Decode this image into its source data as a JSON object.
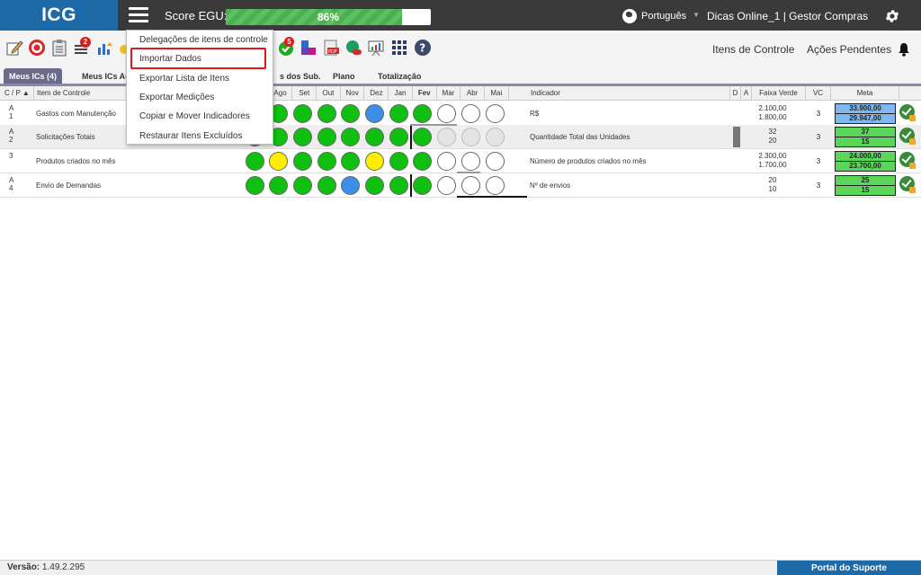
{
  "header": {
    "logo": "ICG",
    "score_label": "Score EGU:",
    "score_percent": 86,
    "score_text": "86%",
    "language": "Português",
    "user": "Dicas Online_1  |  Gestor Compras"
  },
  "toolbar": {
    "badge1": "2",
    "badge2": "5",
    "right_links": [
      "Itens de Controle",
      "Ações Pendentes"
    ]
  },
  "tabs": [
    {
      "label": "Meus ICs (4)",
      "active": true
    },
    {
      "label": "Meus ICs Au",
      "active": false
    },
    {
      "label": "s dos Sub.",
      "active": false
    },
    {
      "label": "Plano",
      "active": false
    },
    {
      "label": "Totalização",
      "active": false
    }
  ],
  "table": {
    "headers": {
      "cp": "C / P",
      "item": "Item de Controle",
      "months": [
        "ul",
        "Ago",
        "Set",
        "Out",
        "Nov",
        "Dez",
        "Jan",
        "Fev",
        "Mar",
        "Abr",
        "Mai"
      ],
      "indicator": "Indicador",
      "d": "D",
      "a": "A",
      "fv": "Faixa Verde",
      "vc": "VC",
      "meta": "Meta"
    },
    "rows": [
      {
        "cp": [
          "A",
          "1"
        ],
        "item": "Gastos com Manutenção",
        "status": [
          "green",
          "green",
          "green",
          "green",
          "green",
          "blue",
          "green",
          "green",
          "empty",
          "empty",
          "empty"
        ],
        "indicator": "R$",
        "fv": [
          "2.100,00",
          "1.800,00"
        ],
        "vc": "3",
        "meta": [
          "33.900,00",
          "29.947,00"
        ],
        "meta_color": "#7fb8ef"
      },
      {
        "cp": [
          "A",
          "2"
        ],
        "item": "Solicitações Totais",
        "status": [
          "green",
          "green",
          "green",
          "green",
          "green",
          "green",
          "green",
          "green",
          "gray",
          "gray",
          "gray"
        ],
        "indicator": "Quantidade Total das Unidades",
        "fv": [
          "32",
          "20"
        ],
        "vc": "3",
        "meta": [
          "37",
          "15"
        ],
        "meta_color": "#5bd65b"
      },
      {
        "cp": [
          "",
          "3"
        ],
        "item": "Produtos criados no mês",
        "status": [
          "green",
          "yellow",
          "green",
          "green",
          "green",
          "yellow",
          "green",
          "green",
          "empty",
          "empty",
          "empty"
        ],
        "indicator": "Número de produtos criados no mês",
        "fv": [
          "2.300,00",
          "1.700,00"
        ],
        "vc": "3",
        "meta": [
          "24.000,00",
          "23.700,00"
        ],
        "meta_color": "#5bd65b"
      },
      {
        "cp": [
          "A",
          "4"
        ],
        "item": "Envio de Demandas",
        "status": [
          "green",
          "green",
          "green",
          "green",
          "blue",
          "green",
          "green",
          "green",
          "empty",
          "empty",
          "empty"
        ],
        "indicator": "Nº de envios",
        "fv": [
          "20",
          "10"
        ],
        "vc": "3",
        "meta": [
          "25",
          "15"
        ],
        "meta_color": "#5bd65b"
      }
    ]
  },
  "menu": {
    "items": [
      "Delegações de itens de controle",
      "Importar Dados",
      "Exportar Lista de Itens",
      "Exportar Medições",
      "Copiar e Mover Indicadores",
      "Restaurar Itens Excluídos"
    ],
    "highlighted": "Importar Dados"
  },
  "footer": {
    "version_label": "Versão:",
    "version": "1.49.2.295",
    "support": "Portal do Suporte"
  },
  "colors": {
    "green": "#10c010",
    "yellow": "#ffee00",
    "blue": "#3b8fe8",
    "empty": "#ffffff",
    "gray": "#e4e4e4",
    "brand": "#1c6aa8"
  }
}
